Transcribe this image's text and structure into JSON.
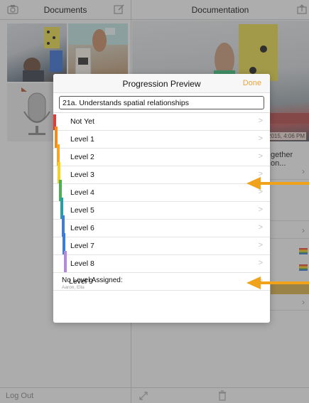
{
  "left_panel": {
    "title": "Documents",
    "logout_label": "Log Out"
  },
  "right_panel": {
    "title": "Documentation",
    "date_badge": "2015, 4:06 PM",
    "row_text": "gether on..."
  },
  "modal": {
    "title": "Progression Preview",
    "done_label": "Done",
    "search_value": "21a. Understands spatial relationships",
    "levels": [
      {
        "label": "Not Yet",
        "bar_color": "#e53935"
      },
      {
        "label": "Level 1",
        "bar_color": "#f28a1c"
      },
      {
        "label": "Level 2",
        "bar_color": "#f5a623"
      },
      {
        "label": "Level 3",
        "bar_color": "#f7d21c"
      },
      {
        "label": "Level 4",
        "bar_color": "#4caf50"
      },
      {
        "label": "Level 5",
        "bar_color": "#1fa2a8"
      },
      {
        "label": "Level 6",
        "bar_color": "#3b7dd8"
      },
      {
        "label": "Level 7",
        "bar_color": "#3b7dd8"
      },
      {
        "label": "Level 8",
        "bar_color": "#b38bd6"
      },
      {
        "label": "Level 9",
        "bar_color": ""
      }
    ],
    "no_level_title": "No Level Assigned:",
    "no_level_names": "Aaron, Ella"
  },
  "colors": {
    "accent": "#e8a33c",
    "arrow": "#f0a31a"
  },
  "icons": [
    "camera-icon",
    "compose-icon",
    "share-icon",
    "chevron-right-icon",
    "expand-icon",
    "trash-icon",
    "flag-icon",
    "arrow-left-icon"
  ]
}
